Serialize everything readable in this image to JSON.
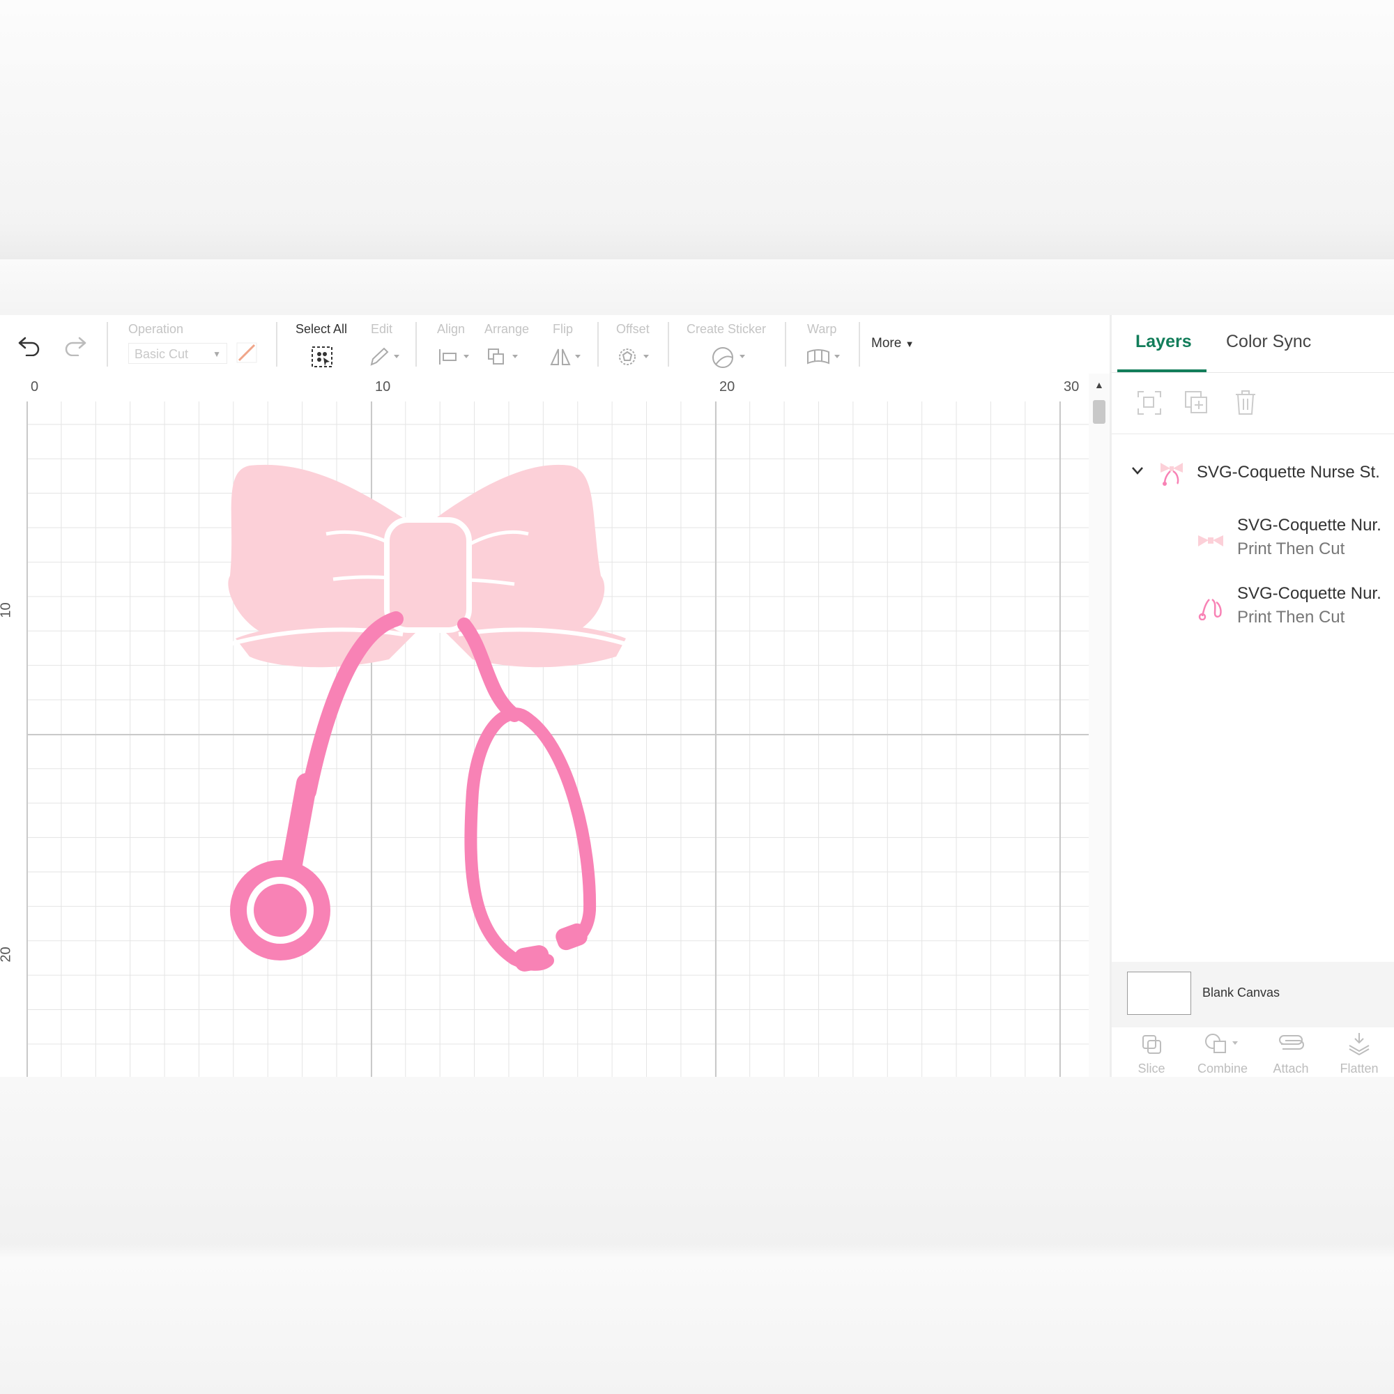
{
  "toolbar": {
    "operation_label": "Operation",
    "operation_value": "Basic Cut",
    "select_all_label": "Select All",
    "edit_label": "Edit",
    "align_label": "Align",
    "arrange_label": "Arrange",
    "flip_label": "Flip",
    "offset_label": "Offset",
    "create_sticker_label": "Create Sticker",
    "warp_label": "Warp",
    "more_label": "More"
  },
  "rulers": {
    "top": [
      "0",
      "10",
      "20",
      "30"
    ],
    "left": [
      "10",
      "20"
    ]
  },
  "panel": {
    "tabs": [
      "Layers",
      "Color Sync"
    ],
    "active_tab": "Layers",
    "group_title": "SVG-Coquette Nurse St.",
    "layers": [
      {
        "name": "SVG-Coquette Nur.",
        "operation": "Print Then Cut",
        "icon": "bow-thumbnail-icon"
      },
      {
        "name": "SVG-Coquette Nur.",
        "operation": "Print Then Cut",
        "icon": "stethoscope-thumbnail-icon"
      }
    ],
    "canvas_label": "Blank Canvas",
    "bottom_tools": [
      "Slice",
      "Combine",
      "Attach",
      "Flatten"
    ]
  },
  "colors": {
    "accent": "#127d5a",
    "bow_pink": "#fcd0d8",
    "stethoscope_pink": "#f882b5"
  }
}
